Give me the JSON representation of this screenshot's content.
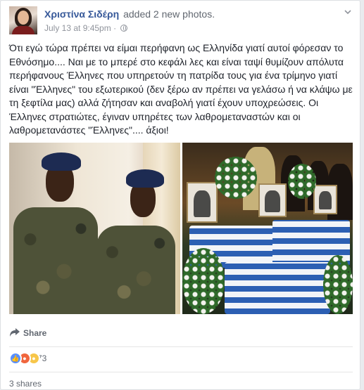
{
  "post": {
    "author": "Χριστίνα Σιδέρη",
    "action": "added 2 new photos.",
    "timestamp": "July 13 at 9:45pm",
    "separator": "·",
    "privacy_icon": "globe-icon",
    "options_icon": "chevron-down-icon",
    "text": "Ότι εγώ τώρα πρέπει να είμαι περήφανη ως Ελληνίδα γιατί αυτοί φόρεσαν το Εθνόσημο.... Ναι με το μπερέ στο κεφάλι λες και είναι ταψί θυμίζουν απόλυτα περήφανους Έλληνες που υπηρετούν τη πατρίδα τους για ένα τρίμηνο γιατί είναι \"Έλληνες\" του εξωτερικού (δεν ξέρω αν πρέπει να γελάσω ή να κλάψω με τη ξεφτίλα μας) αλλά ζήτησαν και αναβολή γιατί έχουν υποχρεώσεις. Οι Έλληνες στρατιώτες, έγιναν υπηρέτες των λαθρομεταναστών και οι λαθρομετανάστες \"Έλληνες\".... άξιοι!"
  },
  "actions": {
    "share_label": "Share",
    "share_icon": "share-arrow-icon"
  },
  "reactions": {
    "icons": [
      "like-icon",
      "angry-icon",
      "sad-icon"
    ],
    "count": "73"
  },
  "footer": {
    "shares_label": "3 shares"
  },
  "colors": {
    "link_blue": "#365899",
    "meta_gray": "#90949c",
    "like_blue": "#5890ff",
    "angry_orange": "#f0663e",
    "sad_yellow": "#f7c64a"
  }
}
